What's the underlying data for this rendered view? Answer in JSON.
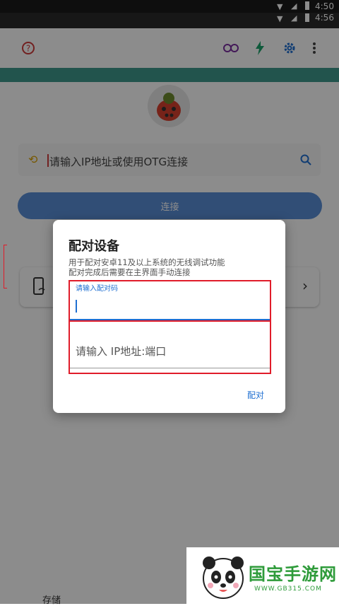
{
  "status_bar": {
    "time_top": "4:50",
    "time_second": "4:56"
  },
  "app": {
    "search_placeholder": "请输入IP地址或使用OTG连接",
    "connect_label": "连接",
    "bottom_partial": "存储"
  },
  "dialog": {
    "title": "配对设备",
    "description_line1": "用于配对安卓11及以上系统的无线调试功能",
    "description_line2": "配对完成后需要在主界面手动连接",
    "pair_code_label": "请输入配对码",
    "ip_port_placeholder": "请输入 IP地址:端口",
    "pair_button": "配对"
  },
  "watermark": {
    "title": "国宝手游网",
    "subtitle": "WWW.GB315.COM"
  },
  "colors": {
    "accent": "#1f6fd1",
    "highlight": "#e01c2a",
    "watermark_green": "#2e9b3a"
  }
}
